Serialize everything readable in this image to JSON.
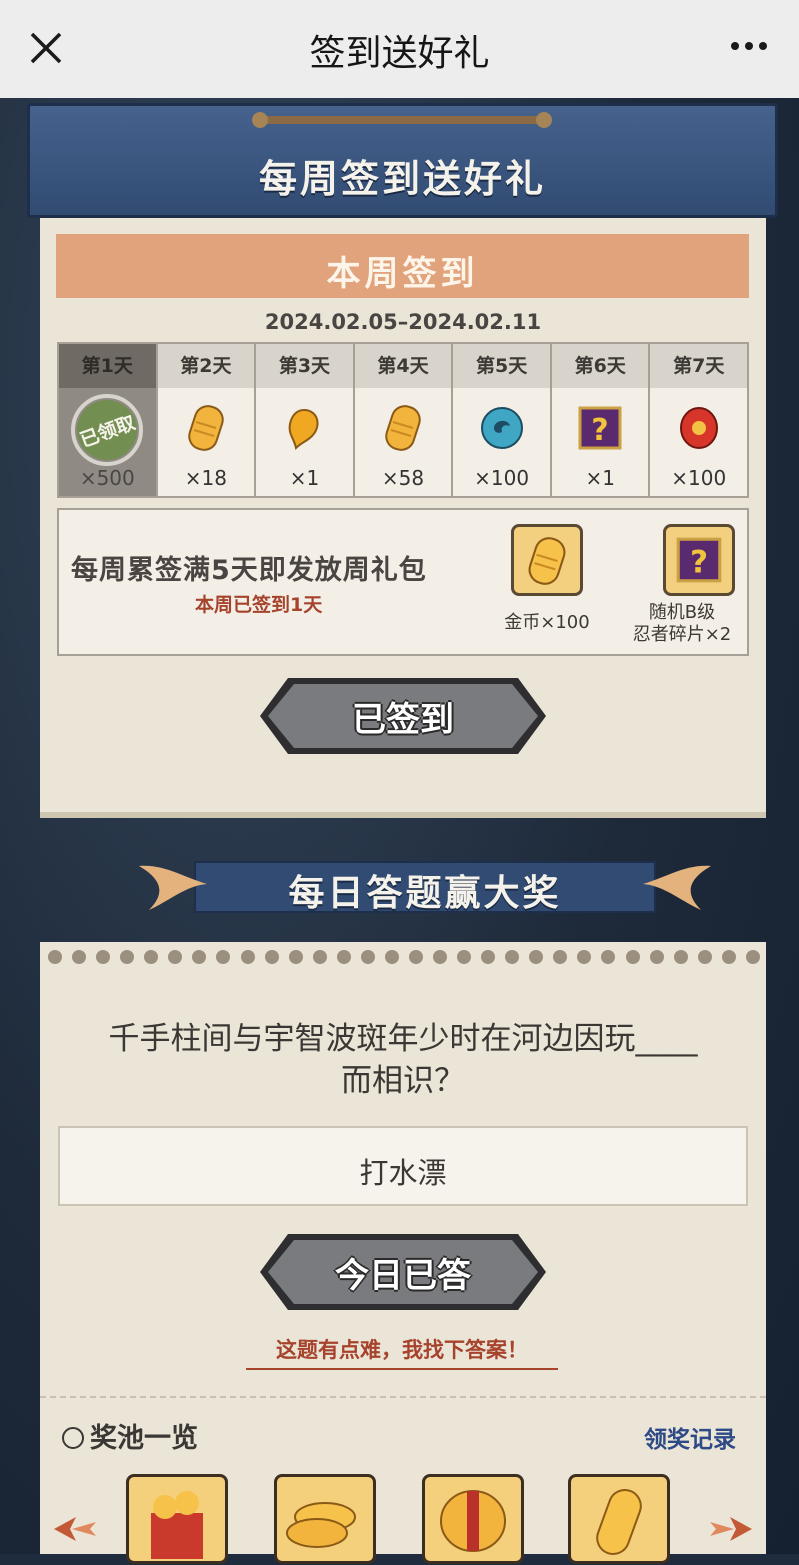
{
  "topbar": {
    "title": "签到送好礼"
  },
  "checkin": {
    "banner_title": "每周签到送好礼",
    "section_title": "本周签到",
    "date_range": "2024.02.05–2024.02.11",
    "claimed_stamp": "已领取",
    "days": [
      {
        "label": "第1天",
        "qty": "×500",
        "icon": "jade-icon",
        "claimed": true
      },
      {
        "label": "第2天",
        "qty": "×18",
        "icon": "gold-coin-icon",
        "claimed": false
      },
      {
        "label": "第3天",
        "qty": "×1",
        "icon": "magatama-icon",
        "claimed": false
      },
      {
        "label": "第4天",
        "qty": "×58",
        "icon": "gold-coin-icon",
        "claimed": false
      },
      {
        "label": "第5天",
        "qty": "×100",
        "icon": "blue-orb-icon",
        "claimed": false
      },
      {
        "label": "第6天",
        "qty": "×1",
        "icon": "mystery-shard-icon",
        "claimed": false
      },
      {
        "label": "第7天",
        "qty": "×100",
        "icon": "red-scroll-icon",
        "claimed": false
      }
    ],
    "weekly": {
      "title": "每周累签满5天即发放周礼包",
      "progress": "本周已签到1天",
      "reward1": "金币×100",
      "reward2_line1": "随机B级",
      "reward2_line2": "忍者碎片×2"
    },
    "button_label": "已签到"
  },
  "quiz": {
    "banner_title": "每日答题赢大奖",
    "question_line1": "千手柱间与宇智波斑年少时在河边因玩____",
    "question_line2": "而相识？",
    "answer": "打水漂",
    "button_label": "今日已答",
    "hint": "这题有点难，我找下答案！",
    "pool_title": "奖池一览",
    "records_link": "领奖记录"
  },
  "colors": {
    "accent_red": "#a6432d",
    "banner_blue": "#3b5680",
    "paper": "#ebe5d7",
    "link_blue": "#2d4a86"
  }
}
